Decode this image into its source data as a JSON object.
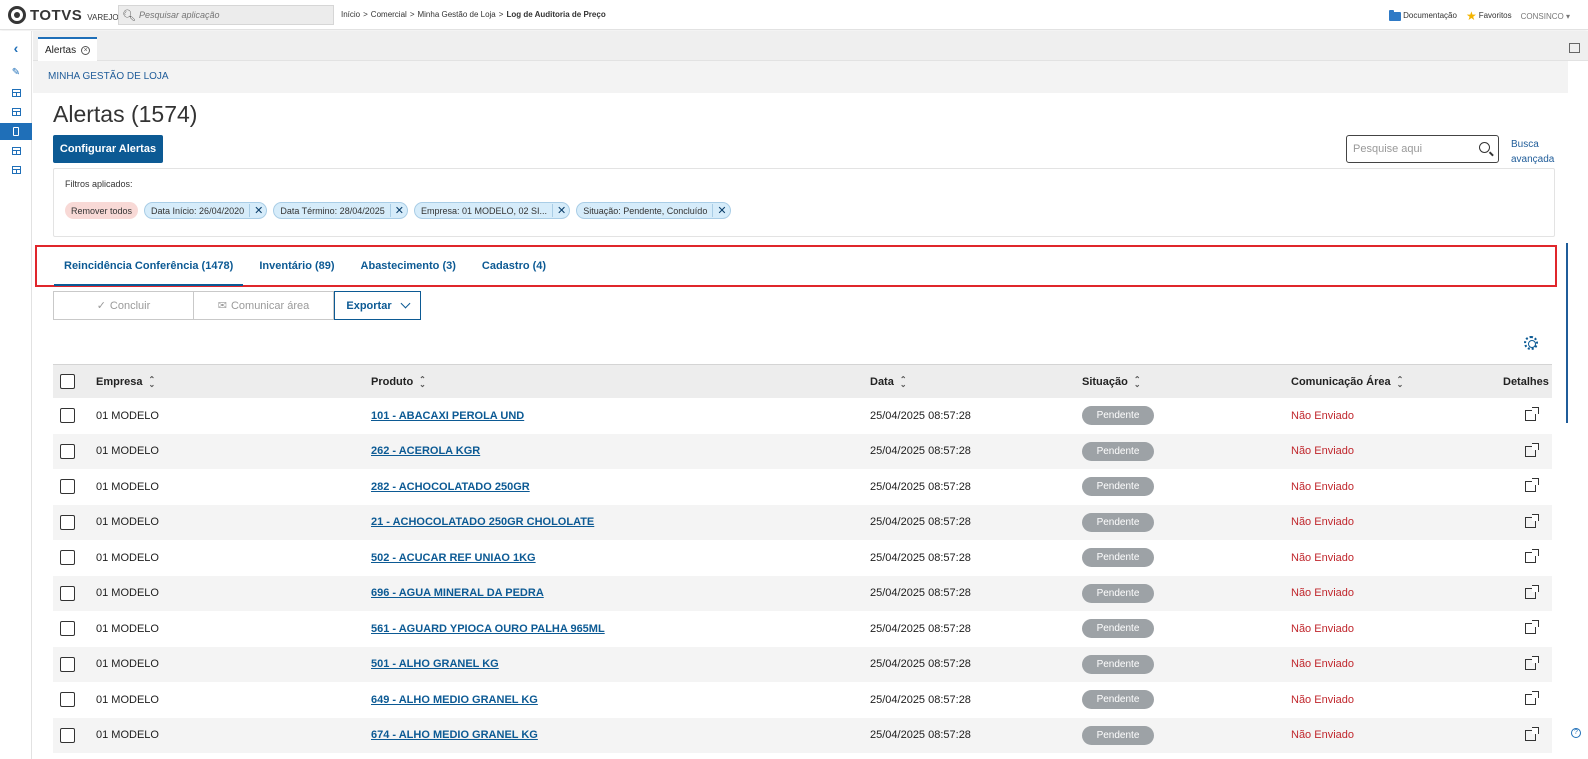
{
  "header": {
    "brand": "TOTVS",
    "brand_sub": "VAREJO",
    "search_placeholder": "Pesquisar aplicação",
    "breadcrumb": [
      "Início",
      "Comercial",
      "Minha Gestão de Loja",
      "Log de Auditoria de Preço"
    ],
    "breadcrumb_sep": ">",
    "docs_label": "Documentação",
    "favorites_label": "Favoritos",
    "user_label": "CONSINCO"
  },
  "doc_tab": {
    "label": "Alertas",
    "close_symbol": "⊗"
  },
  "section": {
    "title": "MINHA GESTÃO DE LOJA"
  },
  "page": {
    "title": "Alertas (1574)",
    "configure_button": "Configurar Alertas",
    "search_placeholder": "Pesquise aqui",
    "advanced_search": "Busca avançada"
  },
  "filters": {
    "label": "Filtros aplicados:",
    "remove_all": "Remover todos",
    "chips": [
      "Data Início: 26/04/2020",
      "Data Término: 28/04/2025",
      "Empresa: 01 MODELO, 02 SI...",
      "Situação: Pendente, Concluído"
    ],
    "chip_close": "✕"
  },
  "tabs": [
    {
      "label": "Reincidência Conferência (1478)",
      "active": true
    },
    {
      "label": "Inventário (89)",
      "active": false
    },
    {
      "label": "Abastecimento (3)",
      "active": false
    },
    {
      "label": "Cadastro (4)",
      "active": false
    }
  ],
  "actions": {
    "concluir": "Concluir",
    "comunicar": "Comunicar área",
    "exportar": "Exportar"
  },
  "table": {
    "columns": {
      "empresa": "Empresa",
      "produto": "Produto",
      "data": "Data",
      "situacao": "Situação",
      "comunicacao": "Comunicação Área",
      "detalhes": "Detalhes"
    },
    "rows": [
      {
        "empresa": "01 MODELO",
        "produto": "101 - ABACAXI PEROLA UND",
        "data": "25/04/2025 08:57:28",
        "situacao": "Pendente",
        "comunicacao": "Não Enviado"
      },
      {
        "empresa": "01 MODELO",
        "produto": "262 - ACEROLA KGR",
        "data": "25/04/2025 08:57:28",
        "situacao": "Pendente",
        "comunicacao": "Não Enviado"
      },
      {
        "empresa": "01 MODELO",
        "produto": "282 - ACHOCOLATADO 250GR",
        "data": "25/04/2025 08:57:28",
        "situacao": "Pendente",
        "comunicacao": "Não Enviado"
      },
      {
        "empresa": "01 MODELO",
        "produto": "21 - ACHOCOLATADO 250GR CHOLOLATE",
        "data": "25/04/2025 08:57:28",
        "situacao": "Pendente",
        "comunicacao": "Não Enviado"
      },
      {
        "empresa": "01 MODELO",
        "produto": "502 - ACUCAR REF UNIAO 1KG",
        "data": "25/04/2025 08:57:28",
        "situacao": "Pendente",
        "comunicacao": "Não Enviado"
      },
      {
        "empresa": "01 MODELO",
        "produto": "696 - AGUA MINERAL DA PEDRA",
        "data": "25/04/2025 08:57:28",
        "situacao": "Pendente",
        "comunicacao": "Não Enviado"
      },
      {
        "empresa": "01 MODELO",
        "produto": "561 - AGUARD YPIOCA OURO PALHA 965ML",
        "data": "25/04/2025 08:57:28",
        "situacao": "Pendente",
        "comunicacao": "Não Enviado"
      },
      {
        "empresa": "01 MODELO",
        "produto": "501 - ALHO GRANEL KG",
        "data": "25/04/2025 08:57:28",
        "situacao": "Pendente",
        "comunicacao": "Não Enviado"
      },
      {
        "empresa": "01 MODELO",
        "produto": "649 - ALHO MEDIO GRANEL KG",
        "data": "25/04/2025 08:57:28",
        "situacao": "Pendente",
        "comunicacao": "Não Enviado"
      },
      {
        "empresa": "01 MODELO",
        "produto": "674 - ALHO MEDIO GRANEL KG",
        "data": "25/04/2025 08:57:28",
        "situacao": "Pendente",
        "comunicacao": "Não Enviado"
      }
    ]
  },
  "colors": {
    "primary": "#0c5a94",
    "link": "#1f5c99",
    "alert_red": "#c0272d",
    "highlight_outline": "#e0262b",
    "pending_pill": "#9da2a6"
  }
}
